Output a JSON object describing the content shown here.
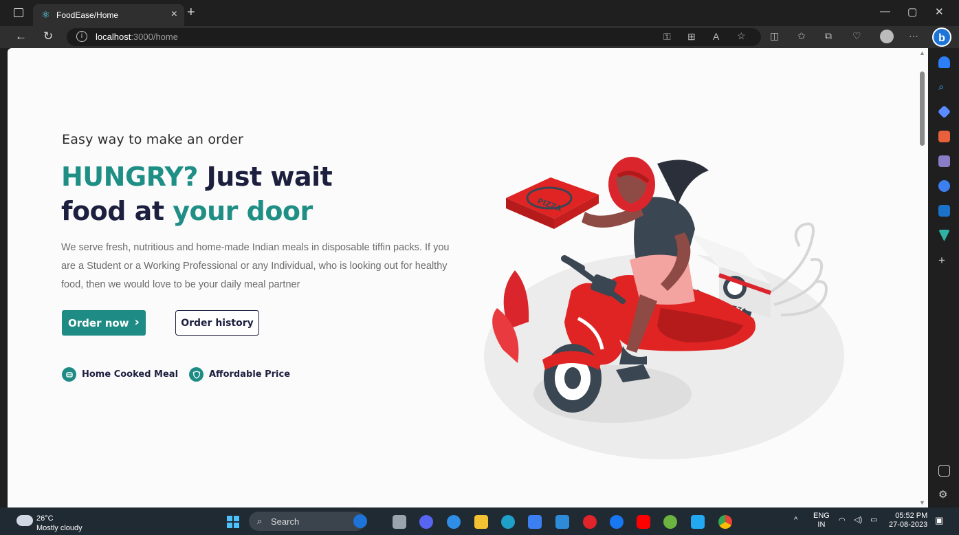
{
  "browser": {
    "tab_title": "FoodEase/Home",
    "url_host": "localhost",
    "url_path": ":3000/home",
    "new_tab_label": "+",
    "close_tab_label": "×"
  },
  "hero": {
    "eyebrow": "Easy way to make an order",
    "headline_part1": "HUNGRY?",
    "headline_part2": " Just wait",
    "headline_part3": "food at ",
    "headline_part4": "your door",
    "description": "We serve fresh, nutritious and home-made Indian meals in disposable tiffin packs. If you are a Student or a Working Professional or any Individual, who is looking out for healthy food, then we would love to be your daily meal partner",
    "order_button": "Order now",
    "order_button_chevron": "›",
    "history_button": "Order history"
  },
  "features": [
    {
      "label": "Home Cooked Meal",
      "icon": "meal-icon"
    },
    {
      "label": "Affordable Price",
      "icon": "shield-icon"
    }
  ],
  "illustration": {
    "box_text": "PIZZA",
    "crate_text": "PIZZA"
  },
  "taskbar": {
    "temperature": "26°C",
    "condition": "Mostly cloudy",
    "search_label": "Search",
    "language": "ENG",
    "region": "IN",
    "time": "05:52 PM",
    "date": "27-08-2023"
  },
  "colors": {
    "teal": "#1e8b84",
    "navy": "#1d1f3f",
    "scooter_red": "#e02424"
  }
}
